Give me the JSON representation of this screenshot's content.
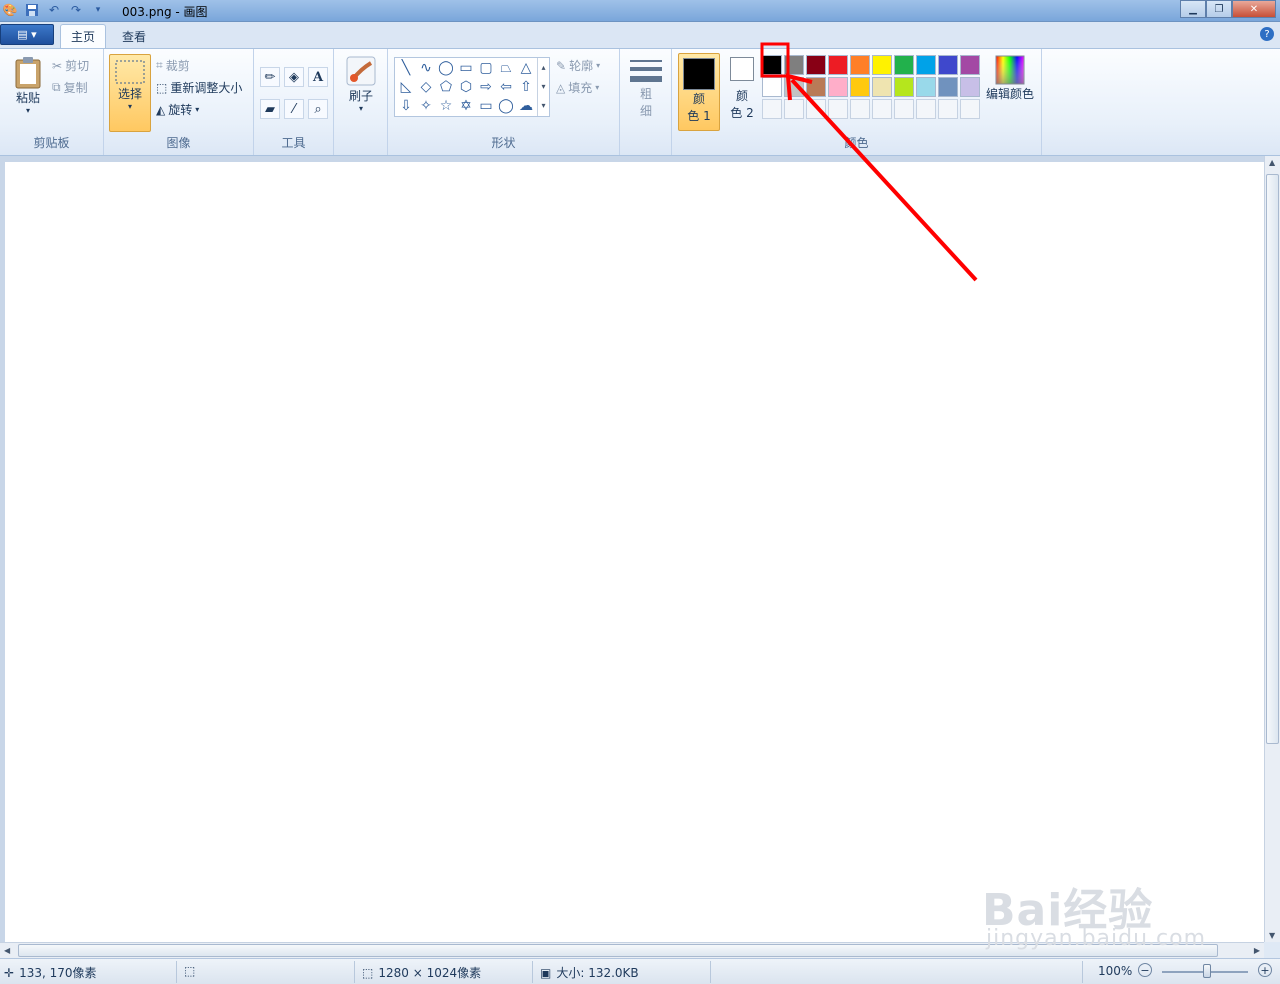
{
  "window": {
    "title": "003.png - 画图",
    "controls": [
      "minimize",
      "restore",
      "close"
    ]
  },
  "tabs": [
    {
      "label": "主页",
      "active": true
    },
    {
      "label": "查看",
      "active": false
    }
  ],
  "ribbon": {
    "clipboard": {
      "group_label": "剪贴板",
      "paste_label": "粘贴",
      "cut_label": "剪切",
      "copy_label": "复制"
    },
    "image": {
      "group_label": "图像",
      "select_label": "选择",
      "crop_label": "裁剪",
      "resize_label": "重新调整大小",
      "rotate_label": "旋转"
    },
    "tools": {
      "group_label": "工具",
      "items": [
        "pencil",
        "fill",
        "text",
        "eraser",
        "color-picker",
        "magnifier"
      ]
    },
    "brushes": {
      "label": "刷子"
    },
    "shapes": {
      "group_label": "形状",
      "outline_label": "轮廓",
      "fill_label": "填充"
    },
    "size": {
      "label_line1": "粗",
      "label_line2": "细"
    },
    "colors": {
      "group_label": "颜色",
      "color1_label_line1": "颜",
      "color1_label_line2": "色 1",
      "color2_label_line1": "颜",
      "color2_label_line2": "色 2",
      "color1_value": "#000000",
      "color2_value": "#ffffff",
      "edit_colors_label": "编辑颜色",
      "palette_row1": [
        "#000000",
        "#7f7f7f",
        "#880015",
        "#ed1c24",
        "#ff7f27",
        "#fff200",
        "#22b14c",
        "#00a2e8",
        "#3f48cc",
        "#a349a4"
      ],
      "palette_row2": [
        "#ffffff",
        "#c3c3c3",
        "#b97a57",
        "#ffaec9",
        "#ffc90e",
        "#efe4b0",
        "#b5e61d",
        "#99d9ea",
        "#7092be",
        "#c8bfe7"
      ]
    }
  },
  "statusbar": {
    "cursor_pos": "133, 170像素",
    "canvas_size": "1280 × 1024像素",
    "file_size": "大小: 132.0KB",
    "zoom": "100%"
  },
  "watermark": {
    "brand": "Bai经验",
    "url": "jingyan.baidu.com"
  },
  "annotation": {
    "color": "#ff0000"
  }
}
